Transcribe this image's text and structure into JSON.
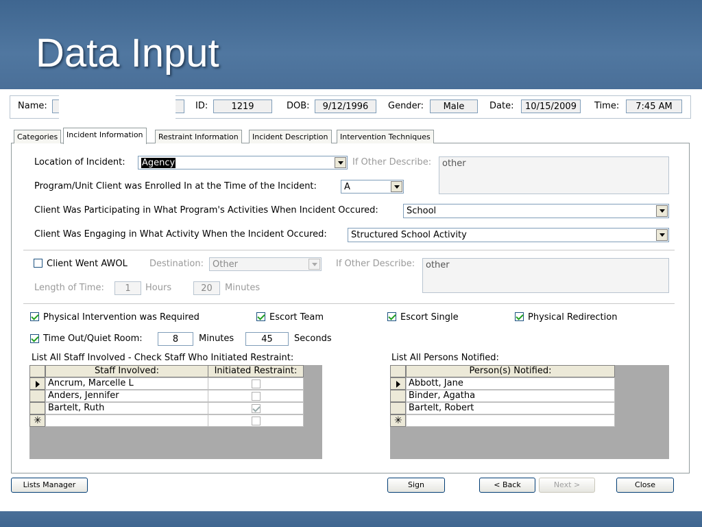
{
  "slide": {
    "title": "Data Input"
  },
  "header": {
    "name_label": "Name:",
    "name_value": "",
    "id_label": "ID:",
    "id_value": "1219",
    "dob_label": "DOB:",
    "dob_value": "9/12/1996",
    "gender_label": "Gender:",
    "gender_value": "Male",
    "date_label": "Date:",
    "date_value": "10/15/2009",
    "time_label": "Time:",
    "time_value": "7:45 AM"
  },
  "tabs": [
    {
      "label": "Categories",
      "active": false
    },
    {
      "label": "Incident Information",
      "active": true
    },
    {
      "label": "Restraint Information",
      "active": false
    },
    {
      "label": "Incident Description",
      "active": false
    },
    {
      "label": "Intervention Techniques",
      "active": false
    }
  ],
  "incident": {
    "location_label": "Location of Incident:",
    "location_value": "Agency",
    "other_describe_label": "If Other Describe:",
    "other_describe_value": "other",
    "program_label": "Program/Unit Client was Enrolled In at the Time of the Incident:",
    "program_value": "A",
    "participating_label": "Client Was Participating in What Program's Activities When Incident Occured:",
    "participating_value": "School",
    "engaging_label": "Client Was Engaging in What Activity When the Incident Occured:",
    "engaging_value": "Structured School Activity"
  },
  "awol": {
    "checkbox_label": "Client Went AWOL",
    "checked": false,
    "destination_label": "Destination:",
    "destination_value": "Other",
    "other_describe_label": "If Other Describe:",
    "other_describe_value": "other",
    "length_label": "Length of Time:",
    "hours_value": "1",
    "hours_label": "Hours",
    "minutes_value": "20",
    "minutes_label": "Minutes"
  },
  "intervention": {
    "physical_required_label": "Physical Intervention was Required",
    "escort_team_label": "Escort Team",
    "escort_single_label": "Escort Single",
    "physical_redirection_label": "Physical Redirection",
    "timeout_label": "Time Out/Quiet Room:",
    "timeout_minutes": "8",
    "minutes_label": "Minutes",
    "timeout_seconds": "45",
    "seconds_label": "Seconds"
  },
  "staff": {
    "list_label": "List All Staff Involved - Check Staff Who Initiated Restraint:",
    "col_staff": "Staff Involved:",
    "col_initiated": "Initiated Restraint:",
    "rows": [
      {
        "name": "Ancrum, Marcelle L",
        "initiated": false
      },
      {
        "name": "Anders, Jennifer",
        "initiated": false
      },
      {
        "name": "Bartelt, Ruth",
        "initiated": true
      }
    ]
  },
  "notified": {
    "list_label": "List All Persons Notified:",
    "col_person": "Person(s) Notified:",
    "rows": [
      {
        "name": "Abbott, Jane"
      },
      {
        "name": "Binder, Agatha"
      },
      {
        "name": "Bartelt, Robert"
      }
    ]
  },
  "buttons": {
    "lists_manager": "Lists Manager",
    "sign": "Sign",
    "back": "< Back",
    "next": "Next >",
    "close": "Close"
  }
}
